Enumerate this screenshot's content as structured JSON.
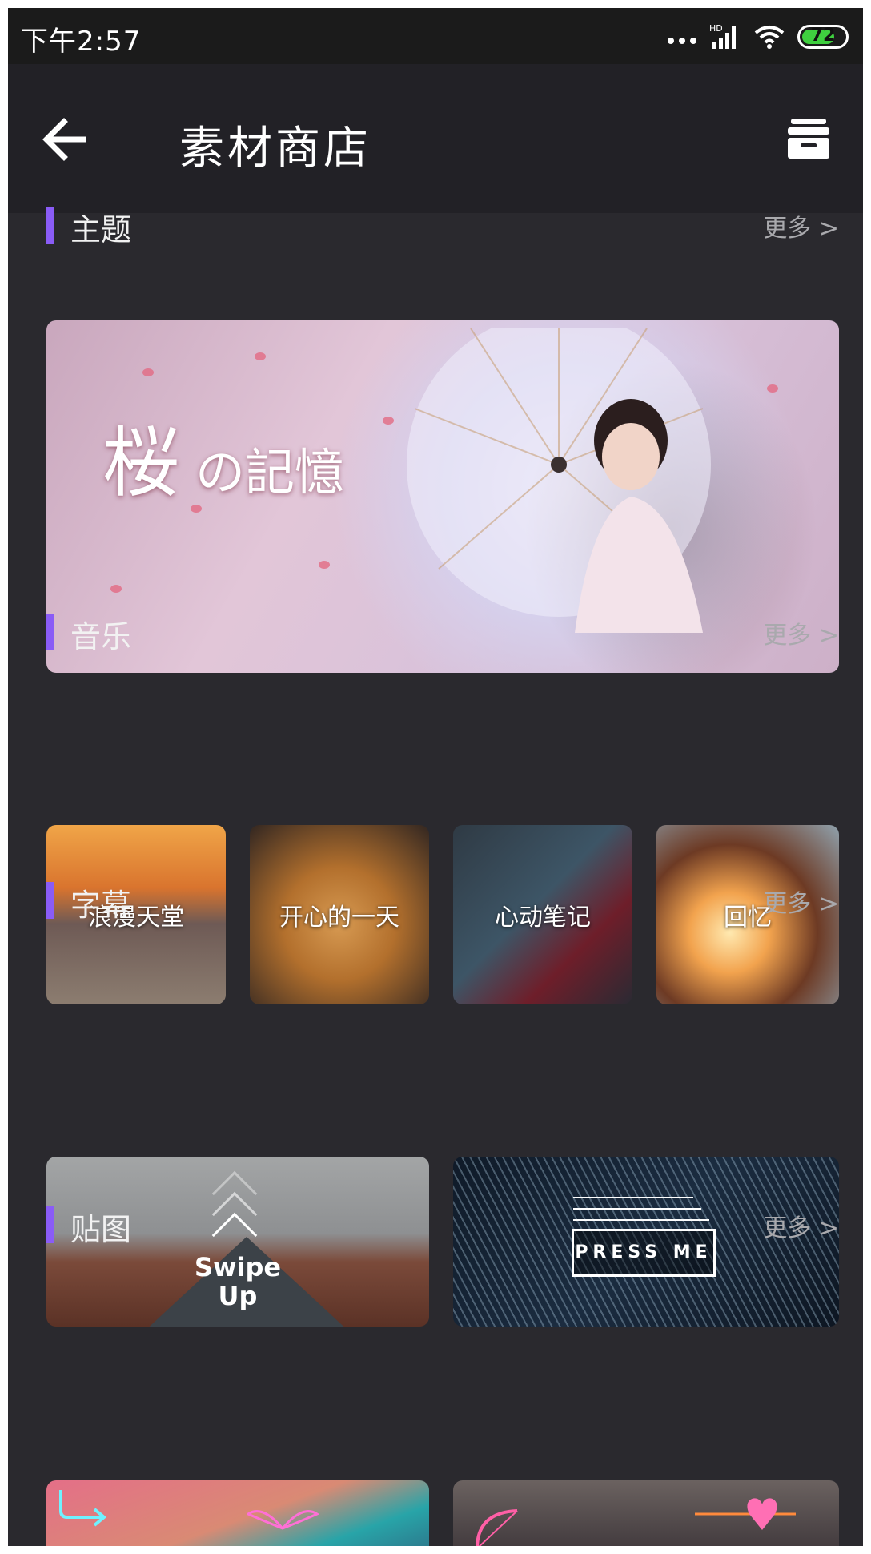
{
  "status_bar": {
    "time": "下午2:57",
    "network": "HD",
    "battery": "72"
  },
  "toolbar": {
    "title": "素材商店"
  },
  "sections": {
    "theme": {
      "title": "主题",
      "more": "更多 >",
      "banner_text_big": "桜",
      "banner_text_rest": "の記憶"
    },
    "music": {
      "title": "音乐",
      "more": "更多 >",
      "items": [
        "浪漫天堂",
        "开心的一天",
        "心动笔记",
        "回忆"
      ]
    },
    "subtitle": {
      "title": "字幕",
      "more": "更多 >",
      "swipe_line1": "Swipe",
      "swipe_line2": "Up",
      "press": "PRESS ME"
    },
    "sticker": {
      "title": "贴图",
      "more": "更多 >"
    }
  },
  "colors": {
    "accent": "#8a5cf6",
    "background": "#2a292e",
    "toolbar": "#222126",
    "status": "#1b1b1b"
  }
}
